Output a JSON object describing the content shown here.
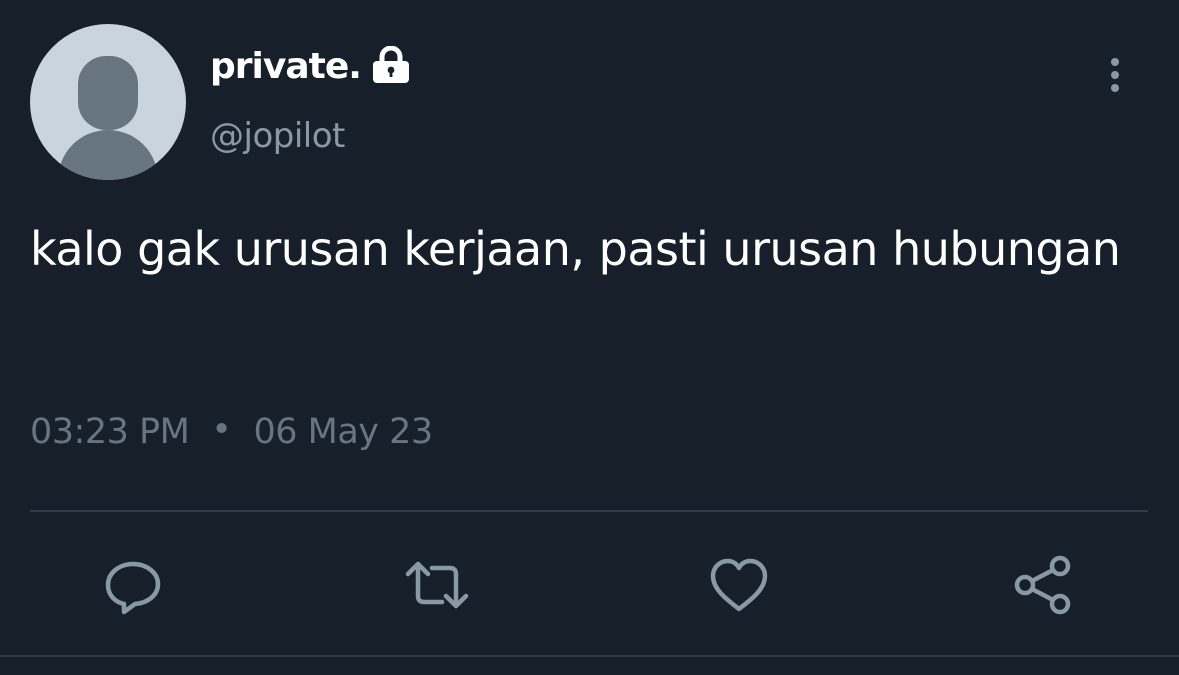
{
  "tweet": {
    "display_name": "private.",
    "handle": "@jopilot",
    "text": "kalo gak urusan kerjaan, pasti urusan hubungan",
    "time": "03:23 PM",
    "separator": "•",
    "date": "06 May 23"
  },
  "icons": {
    "avatar": "default-avatar-icon",
    "lock": "lock-icon",
    "more": "more-vertical-icon",
    "reply": "reply-icon",
    "retweet": "retweet-icon",
    "like": "like-icon",
    "share": "share-icon"
  },
  "colors": {
    "background": "#17202a",
    "primary_text": "#ffffff",
    "secondary_text": "#8899a6",
    "icon": "#8899a6",
    "divider": "#2f3b47"
  }
}
